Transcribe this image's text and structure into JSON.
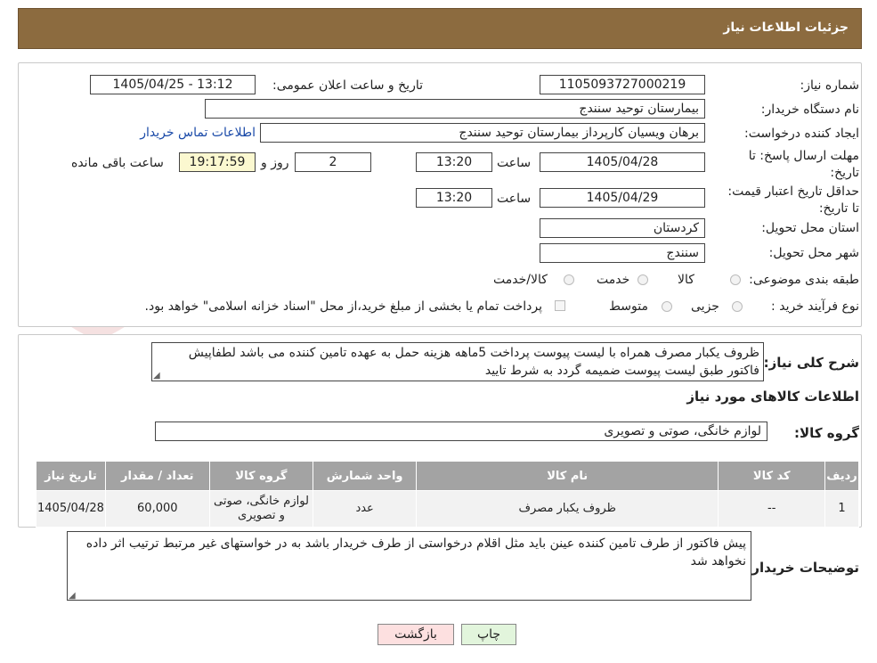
{
  "header": {
    "title": "جزئیات اطلاعات نیاز"
  },
  "info": {
    "need_number_label": "شماره نیاز:",
    "need_number": "1105093727000219",
    "announce_label": "تاریخ و ساعت اعلان عمومی:",
    "announce_value": "1405/04/25 - 13:12",
    "buyer_org_label": "نام دستگاه خریدار:",
    "buyer_org": "بیمارستان توحید سنندج",
    "creator_label": "ایجاد کننده درخواست:",
    "creator": "برهان ویسیان کارپرداز بیمارستان توحید سنندج",
    "contact_link": "اطلاعات تماس خریدار",
    "reply_deadline_label": "مهلت ارسال پاسخ: تا تاریخ:",
    "reply_date": "1405/04/28",
    "time_word": "ساعت",
    "reply_time": "13:20",
    "days_value": "2",
    "days_word": "روز و",
    "remaining_time": "19:17:59",
    "remaining_word": "ساعت باقی مانده",
    "price_validity_label": "حداقل تاریخ اعتبار قیمت: تا تاریخ:",
    "price_date": "1405/04/29",
    "price_time": "13:20",
    "province_label": "استان محل تحویل:",
    "province": "کردستان",
    "city_label": "شهر محل تحویل:",
    "city": "سنندج",
    "category_label": "طبقه بندی موضوعی:",
    "category_options": [
      "کالا",
      "خدمت",
      "کالا/خدمت"
    ],
    "process_label": "نوع فرآیند خرید :",
    "process_options": [
      "جزیی",
      "متوسط"
    ],
    "payment_note": "پرداخت تمام یا بخشی از مبلغ خرید،از محل \"اسناد خزانه اسلامی\" خواهد بود."
  },
  "description": {
    "label": "شرح کلی نیاز:",
    "text": "ظروف یکبار مصرف همراه با لیست پیوست پرداخت 5ماهه هزینه حمل به عهده تامین کننده می باشد لطفاپیش فاکتور  طبق لیست پیوست ضمیمه گردد به شرط تایید"
  },
  "goods": {
    "section_title": "اطلاعات کالاهای مورد نیاز",
    "group_label": "گروه کالا:",
    "group_value": "لوازم خانگی، صوتی و تصویری",
    "columns": [
      "ردیف",
      "کد کالا",
      "نام کالا",
      "واحد شمارش",
      "گروه کالا",
      "تعداد / مقدار",
      "تاریخ نیاز"
    ],
    "rows": [
      {
        "row": "1",
        "code": "--",
        "name": "ظروف یکبار مصرف",
        "unit": "عدد",
        "group": "لوازم خانگی، صوتی و تصویری",
        "qty": "60,000",
        "date": "1405/04/28"
      }
    ]
  },
  "buyer_notes": {
    "label": "توضیحات خریدار:",
    "text": "پیش فاکتور از طرف تامین کننده عینن باید مثل اقلام درخواستی از طرف خریدار باشد به در خواستهای غیر مرتبط ترتیب اثر داده نخواهد شد"
  },
  "buttons": {
    "back": "بازگشت",
    "print": "چاپ"
  },
  "colors": {
    "header_bg": "#8c6b3f",
    "table_header": "#a3a3a3",
    "back_btn": "#fde0e0",
    "print_btn": "#e2f5dc",
    "link": "#1a4aa8"
  }
}
